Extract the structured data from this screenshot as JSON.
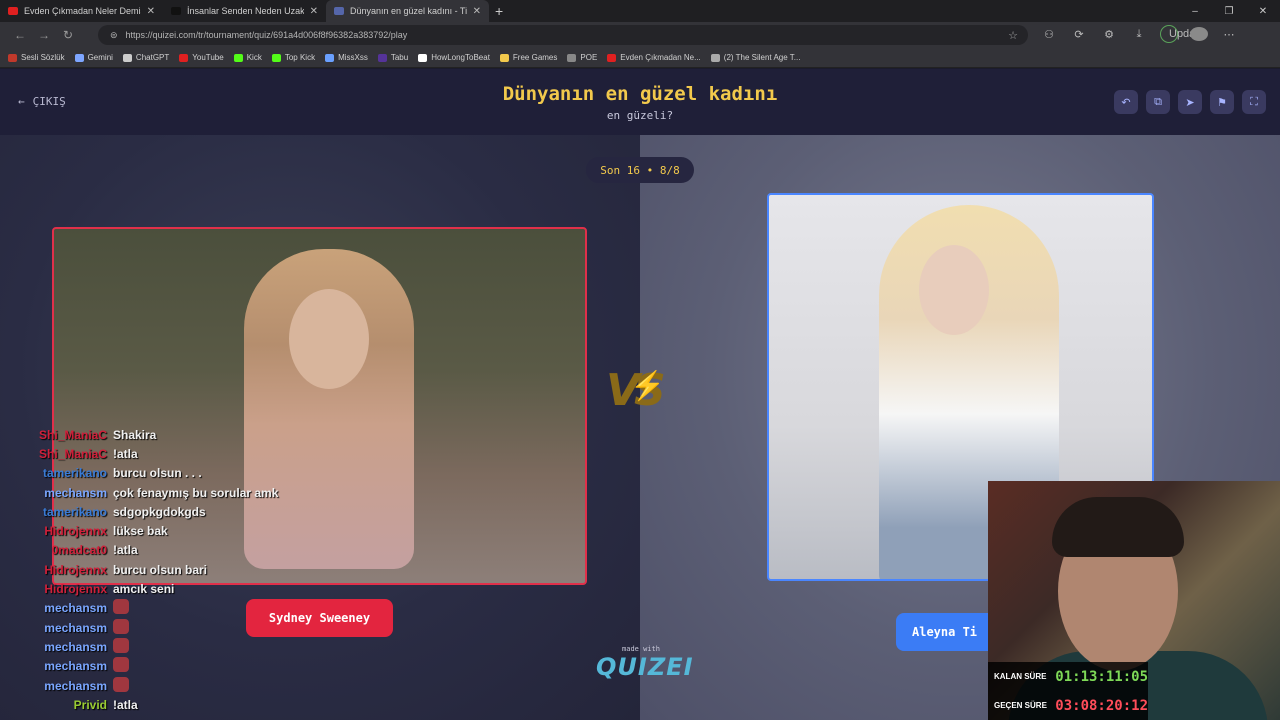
{
  "browser": {
    "tabs": [
      {
        "title": "Evden Çıkmadan Neler Demişim !",
        "icon_color": "#e02020",
        "active": false
      },
      {
        "title": "İnsanlar Senden Neden Uzaklaşıy",
        "icon_color": "#111111",
        "active": false
      },
      {
        "title": "Dünyanın en güzel kadını - Tier Li",
        "icon_color": "#5566aa",
        "active": true
      }
    ],
    "new_tab": "+",
    "window_controls": [
      "–",
      "❐",
      "✕"
    ],
    "url": "https://quizei.com/tr/tournament/quiz/691a4d006f8f96382a383792/play",
    "update_label": "Update",
    "bookmarks": [
      {
        "label": "Sesli Sözlük",
        "color": "#c0392b"
      },
      {
        "label": "Gemini",
        "color": "#7ea6ff"
      },
      {
        "label": "ChatGPT",
        "color": "#cccccc"
      },
      {
        "label": "YouTube",
        "color": "#e02020"
      },
      {
        "label": "Kick",
        "color": "#53fc18"
      },
      {
        "label": "Top Kick",
        "color": "#53fc18"
      },
      {
        "label": "MissXss",
        "color": "#6aa0ff"
      },
      {
        "label": "Tabu",
        "color": "#553399"
      },
      {
        "label": "HowLongToBeat",
        "color": "#ffffff"
      },
      {
        "label": "Free Games",
        "color": "#f2c94c"
      },
      {
        "label": "POE",
        "color": "#888888"
      },
      {
        "label": "Evden Çıkmadan Ne...",
        "color": "#e02020"
      },
      {
        "label": "(2) The Silent Age T...",
        "color": "#aaaaaa"
      }
    ]
  },
  "header": {
    "back_label": "ÇIKIŞ",
    "title": "Dünyanın en güzel kadını",
    "subtitle": "en güzeli?",
    "buttons": [
      "undo-icon",
      "share-icon",
      "send-icon",
      "flag-icon",
      "fullscreen-icon"
    ]
  },
  "round": {
    "label": "Son 16 • 8/8"
  },
  "matchup": {
    "left_name": "Sydney Sweeney",
    "right_name": "Aleyna Ti",
    "vs_label": "VS"
  },
  "branding": {
    "made_with": "made with",
    "logo": "QUIZEI"
  },
  "chat": [
    {
      "user": "Shi_ManiaC",
      "text": "Shakira",
      "color": "#d0203a"
    },
    {
      "user": "Shi_ManiaC",
      "text": "!atla",
      "color": "#d0203a"
    },
    {
      "user": "tamerikano",
      "text": "burcu olsun . . .",
      "color": "#3a7bd5"
    },
    {
      "user": "mechansm",
      "text": "çok fenaymış bu sorular amk",
      "color": "#7aa6ff"
    },
    {
      "user": "tamerikano",
      "text": "sdgopkgdokgds",
      "color": "#3a7bd5"
    },
    {
      "user": "Hidrojennx",
      "text": "lükse bak",
      "color": "#d0203a"
    },
    {
      "user": "0madcat0",
      "text": "!atla",
      "color": "#d0203a"
    },
    {
      "user": "Hidrojennx",
      "text": "burcu olsun bari",
      "color": "#d0203a"
    },
    {
      "user": "Hidrojennx",
      "text": "amcık seni",
      "color": "#d0203a"
    },
    {
      "user": "mechansm",
      "text": "",
      "emote": true,
      "color": "#7aa6ff"
    },
    {
      "user": "mechansm",
      "text": "",
      "emote": true,
      "color": "#7aa6ff"
    },
    {
      "user": "mechansm",
      "text": "",
      "emote": true,
      "color": "#7aa6ff"
    },
    {
      "user": "mechansm",
      "text": "",
      "emote": true,
      "color": "#7aa6ff"
    },
    {
      "user": "mechansm",
      "text": "",
      "emote": true,
      "color": "#7aa6ff"
    },
    {
      "user": "Privid",
      "text": "!atla",
      "color": "#9acd32"
    }
  ],
  "timers": {
    "remaining_label": "KALAN SÜRE",
    "remaining_value": "01:13:11:05",
    "remaining_color": "#7ed957",
    "elapsed_label": "GEÇEN SÜRE",
    "elapsed_value": "03:08:20:12",
    "elapsed_color": "#ff4d5a"
  }
}
